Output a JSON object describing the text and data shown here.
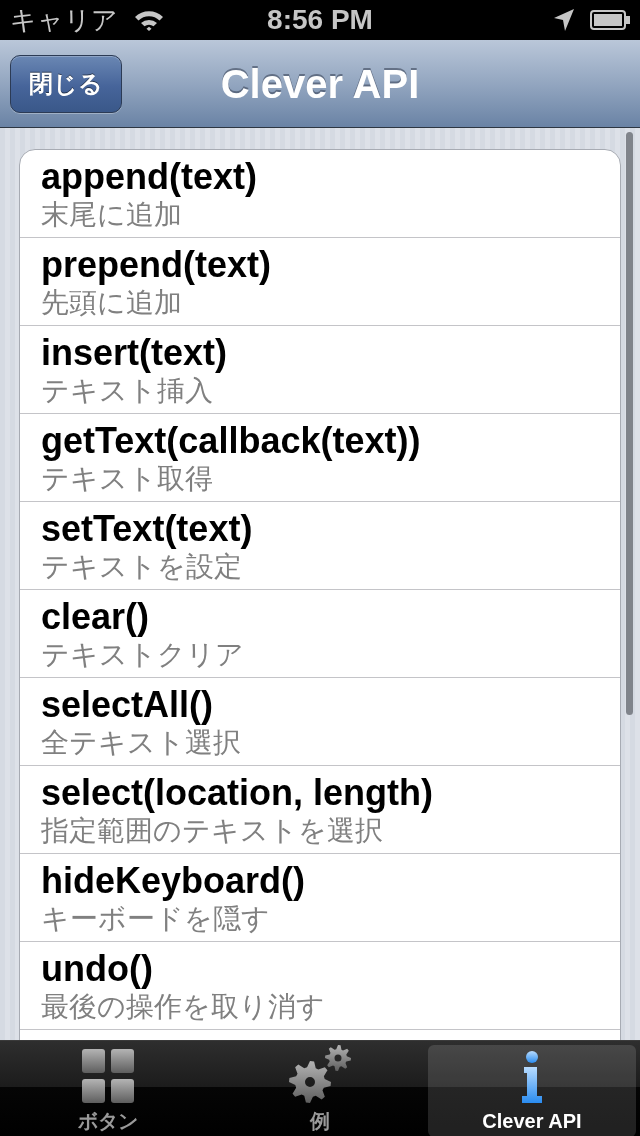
{
  "status_bar": {
    "carrier": "キャリア",
    "time": "8:56 PM"
  },
  "nav_bar": {
    "close_button": "閉じる",
    "title": "Clever API"
  },
  "api_list": [
    {
      "name": "append(text)",
      "description": "末尾に追加"
    },
    {
      "name": "prepend(text)",
      "description": "先頭に追加"
    },
    {
      "name": "insert(text)",
      "description": "テキスト挿入"
    },
    {
      "name": "getText(callback(text))",
      "description": "テキスト取得"
    },
    {
      "name": "setText(text)",
      "description": "テキストを設定"
    },
    {
      "name": "clear()",
      "description": "テキストクリア"
    },
    {
      "name": "selectAll()",
      "description": "全テキスト選択"
    },
    {
      "name": "select(location, length)",
      "description": "指定範囲のテキストを選択"
    },
    {
      "name": "hideKeyboard()",
      "description": "キーボードを隠す"
    },
    {
      "name": "undo()",
      "description": "最後の操作を取り消す"
    }
  ],
  "tab_bar": [
    {
      "kind": "grid",
      "label": "ボタン",
      "selected": false
    },
    {
      "kind": "gears",
      "label": "例",
      "selected": false
    },
    {
      "kind": "info",
      "label": "Clever API",
      "selected": true
    }
  ]
}
